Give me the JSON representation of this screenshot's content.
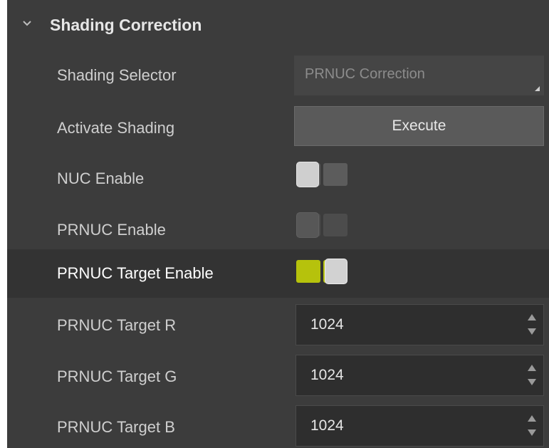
{
  "section": {
    "title": "Shading Correction",
    "expanded": true,
    "icon": "chevron-down-icon"
  },
  "rows": {
    "shading_selector": {
      "label": "Shading Selector",
      "value": "PRNUC Correction",
      "disabled": true
    },
    "activate_shading": {
      "label": "Activate Shading",
      "button": "Execute"
    },
    "nuc_enable": {
      "label": "NUC Enable",
      "on": false
    },
    "prnuc_enable": {
      "label": "PRNUC Enable",
      "on": false,
      "disabled": true
    },
    "prnuc_target_enable": {
      "label": "PRNUC Target Enable",
      "on": true
    },
    "prnuc_target_r": {
      "label": "PRNUC Target R",
      "value": "1024"
    },
    "prnuc_target_g": {
      "label": "PRNUC Target G",
      "value": "1024"
    },
    "prnuc_target_b": {
      "label": "PRNUC Target B",
      "value": "1024"
    }
  },
  "colors": {
    "panel_bg": "#3c3c3c",
    "toggle_on": "#b6c20c",
    "toggle_off": "#5c5c5c"
  }
}
